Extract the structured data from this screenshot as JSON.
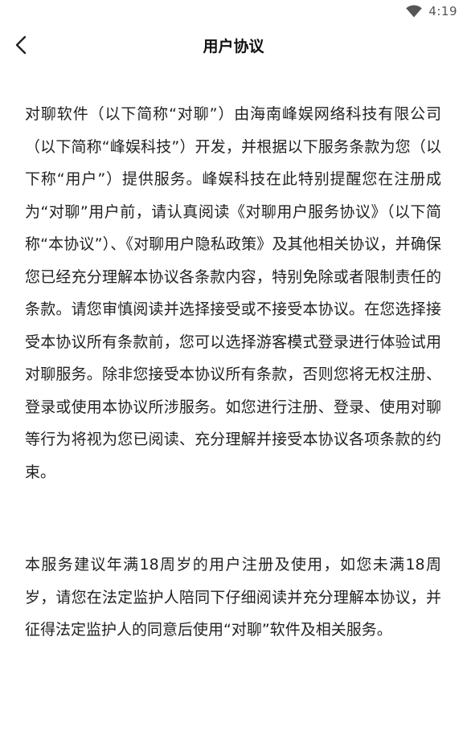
{
  "status_bar": {
    "time": "4:19",
    "icons": [
      "wifi-icon"
    ]
  },
  "header": {
    "back_icon": "chevron-left-icon",
    "title": "用户协议"
  },
  "content": {
    "paragraphs": [
      "对聊软件（以下简称“对聊”）由海南峰娱网络科技有限公司（以下简称“峰娱科技”）开发，并根据以下服务条款为您（以下称“用户”）提供服务。峰娱科技在此特别提醒您在注册成为“对聊”用户前，请认真阅读《对聊用户服务协议》（以下简称“本协议”）、《对聊用户隐私政策》及其他相关协议，并确保您已经充分理解本协议各条款内容，特别免除或者限制责任的条款。请您审慎阅读并选择接受或不接受本协议。在您选择接受本协议所有条款前，您可以选择游客模式登录进行体验试用对聊服务。除非您接受本协议所有条款，否则您将无权注册、登录或使用本协议所涉服务。如您进行注册、登录、使用对聊等行为将视为您已阅读、充分理解并接受本协议各项条款的约束。",
      "本服务建议年满18周岁的用户注册及使用，如您未满18周岁，请您在法定监护人陪同下仔细阅读并充分理解本协议，并征得法定监护人的同意后使用“对聊”软件及相关服务。"
    ]
  }
}
